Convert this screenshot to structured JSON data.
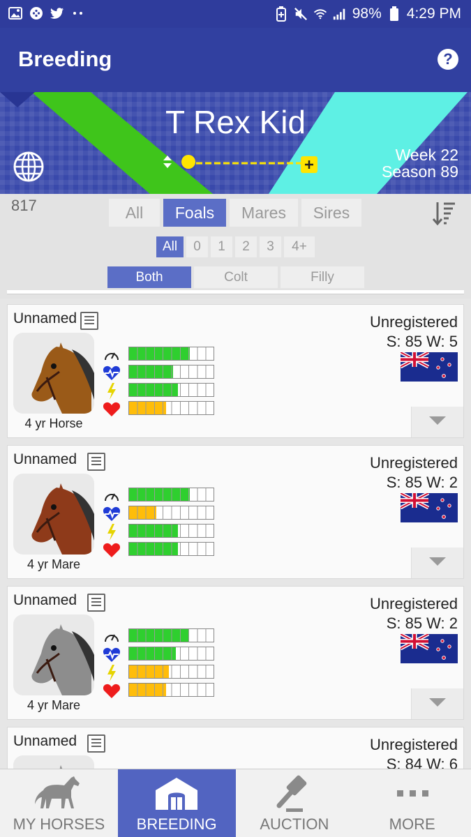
{
  "status_bar": {
    "battery": "98%",
    "time": "4:29 PM"
  },
  "app_bar": {
    "title": "Breeding",
    "help_icon": "help-icon"
  },
  "banner": {
    "horse_name": "T Rex Kid",
    "week": "Week 22",
    "season": "Season 89",
    "colors": {
      "left_stripe": "#3fc51b",
      "right_stripe": "#5ef0e4"
    }
  },
  "filters": {
    "count": "817",
    "tabs": [
      "All",
      "Foals",
      "Mares",
      "Sires"
    ],
    "selected_tab": "Foals",
    "ages": [
      "All",
      "0",
      "1",
      "2",
      "3",
      "4+"
    ],
    "selected_age": "All",
    "genders": [
      "Both",
      "Colt",
      "Filly"
    ],
    "selected_gender": "Both"
  },
  "horses": [
    {
      "name": "Unnamed",
      "age_label": "4 yr Horse",
      "status": "Unregistered",
      "sw": "S: 85 W: 5",
      "coat": "bay",
      "stats": [
        {
          "level": 0.72,
          "color": "green"
        },
        {
          "level": 0.52,
          "color": "green"
        },
        {
          "level": 0.58,
          "color": "green"
        },
        {
          "level": 0.44,
          "color": "orange"
        }
      ]
    },
    {
      "name": "Unnamed",
      "age_label": "4 yr Mare",
      "status": "Unregistered",
      "sw": "S: 85 W: 2",
      "coat": "chestnut",
      "stats": [
        {
          "level": 0.72,
          "color": "green"
        },
        {
          "level": 0.32,
          "color": "orange"
        },
        {
          "level": 0.58,
          "color": "green"
        },
        {
          "level": 0.58,
          "color": "green"
        }
      ]
    },
    {
      "name": "Unnamed",
      "age_label": "4 yr Mare",
      "status": "Unregistered",
      "sw": "S: 85 W: 2",
      "coat": "grey",
      "stats": [
        {
          "level": 0.71,
          "color": "green"
        },
        {
          "level": 0.55,
          "color": "green"
        },
        {
          "level": 0.47,
          "color": "orange"
        },
        {
          "level": 0.44,
          "color": "orange"
        }
      ]
    },
    {
      "name": "Unnamed",
      "age_label": "",
      "status": "Unregistered",
      "sw": "S: 84 W: 6",
      "coat": "grey",
      "stats": []
    }
  ],
  "nav": {
    "items": [
      {
        "label": "MY HORSES",
        "icon": "horse-icon"
      },
      {
        "label": "BREEDING",
        "icon": "barn-icon"
      },
      {
        "label": "AUCTION",
        "icon": "gavel-icon"
      },
      {
        "label": "MORE",
        "icon": "more-icon"
      }
    ],
    "active": "BREEDING"
  }
}
